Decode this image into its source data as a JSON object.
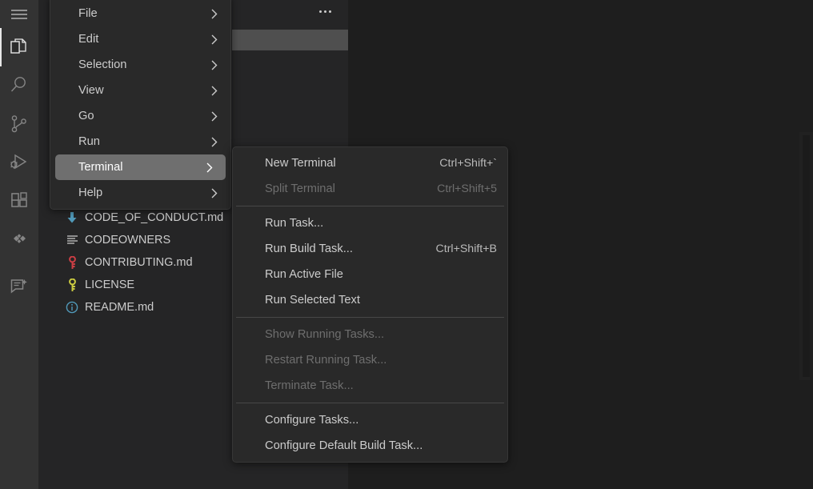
{
  "app": {
    "theme": "Dark+",
    "colors": {
      "editor_background": "#1e1e1e",
      "sidebar_background": "#252526",
      "activitybar_background": "#333333",
      "menu_background": "#292929",
      "menu_selected_background": "#6f6f6f",
      "menu_separator": "#474747",
      "text": "#cccccc",
      "text_disabled": "#6e6e6e",
      "tree_selected_background": "#4f4f4f",
      "accent_blue": "#519aba",
      "accent_red": "#cc3e44",
      "accent_yellow": "#cbcb41"
    }
  },
  "activity_bar": {
    "items": [
      {
        "name": "hamburger-menu",
        "label": "Menu",
        "icon": "hamburger-icon",
        "active": false
      },
      {
        "name": "explorer",
        "label": "Explorer",
        "icon": "files-icon",
        "active": true
      },
      {
        "name": "search",
        "label": "Search",
        "icon": "search-icon",
        "active": false
      },
      {
        "name": "source-control",
        "label": "Source Control",
        "icon": "source-control-icon",
        "active": false
      },
      {
        "name": "run-and-debug",
        "label": "Run and Debug",
        "icon": "run-debug-icon",
        "active": false
      },
      {
        "name": "extensions",
        "label": "Extensions",
        "icon": "extensions-icon",
        "active": false
      },
      {
        "name": "remote-explorer",
        "label": "Remote Explorer",
        "icon": "sparkle-diamond-icon",
        "active": false
      },
      {
        "name": "chat",
        "label": "Chat",
        "icon": "chat-edit-icon",
        "active": false
      }
    ]
  },
  "sidebar": {
    "more_actions_label": "...",
    "files": [
      {
        "name": "CODE_OF_CONDUCT.md",
        "icon": "markdown-arrow-icon",
        "color": "#519aba"
      },
      {
        "name": "CODEOWNERS",
        "icon": "lines-icon",
        "color": "#c5c5c5"
      },
      {
        "name": "CONTRIBUTING.md",
        "icon": "key-icon",
        "color": "#cc3e44"
      },
      {
        "name": "LICENSE",
        "icon": "key-icon",
        "color": "#cbcb41"
      },
      {
        "name": "README.md",
        "icon": "info-circle-icon",
        "color": "#519aba"
      }
    ]
  },
  "menus": {
    "main": {
      "name": "main-menu",
      "items": [
        {
          "label": "File",
          "submenu": true,
          "disabled": false,
          "selected": false
        },
        {
          "label": "Edit",
          "submenu": true,
          "disabled": false,
          "selected": false
        },
        {
          "label": "Selection",
          "submenu": true,
          "disabled": false,
          "selected": false
        },
        {
          "label": "View",
          "submenu": true,
          "disabled": false,
          "selected": false
        },
        {
          "label": "Go",
          "submenu": true,
          "disabled": false,
          "selected": false
        },
        {
          "label": "Run",
          "submenu": true,
          "disabled": false,
          "selected": false
        },
        {
          "label": "Terminal",
          "submenu": true,
          "disabled": false,
          "selected": true
        },
        {
          "label": "Help",
          "submenu": true,
          "disabled": false,
          "selected": false
        }
      ]
    },
    "terminal_submenu": {
      "name": "terminal-submenu",
      "groups": [
        {
          "items": [
            {
              "label": "New Terminal",
              "shortcut": "Ctrl+Shift+`",
              "disabled": false
            },
            {
              "label": "Split Terminal",
              "shortcut": "Ctrl+Shift+5",
              "disabled": true
            }
          ]
        },
        {
          "items": [
            {
              "label": "Run Task...",
              "shortcut": "",
              "disabled": false
            },
            {
              "label": "Run Build Task...",
              "shortcut": "Ctrl+Shift+B",
              "disabled": false
            },
            {
              "label": "Run Active File",
              "shortcut": "",
              "disabled": false
            },
            {
              "label": "Run Selected Text",
              "shortcut": "",
              "disabled": false
            }
          ]
        },
        {
          "items": [
            {
              "label": "Show Running Tasks...",
              "shortcut": "",
              "disabled": true
            },
            {
              "label": "Restart Running Task...",
              "shortcut": "",
              "disabled": true
            },
            {
              "label": "Terminate Task...",
              "shortcut": "",
              "disabled": true
            }
          ]
        },
        {
          "items": [
            {
              "label": "Configure Tasks...",
              "shortcut": "",
              "disabled": false
            },
            {
              "label": "Configure Default Build Task...",
              "shortcut": "",
              "disabled": false
            }
          ]
        }
      ]
    }
  }
}
